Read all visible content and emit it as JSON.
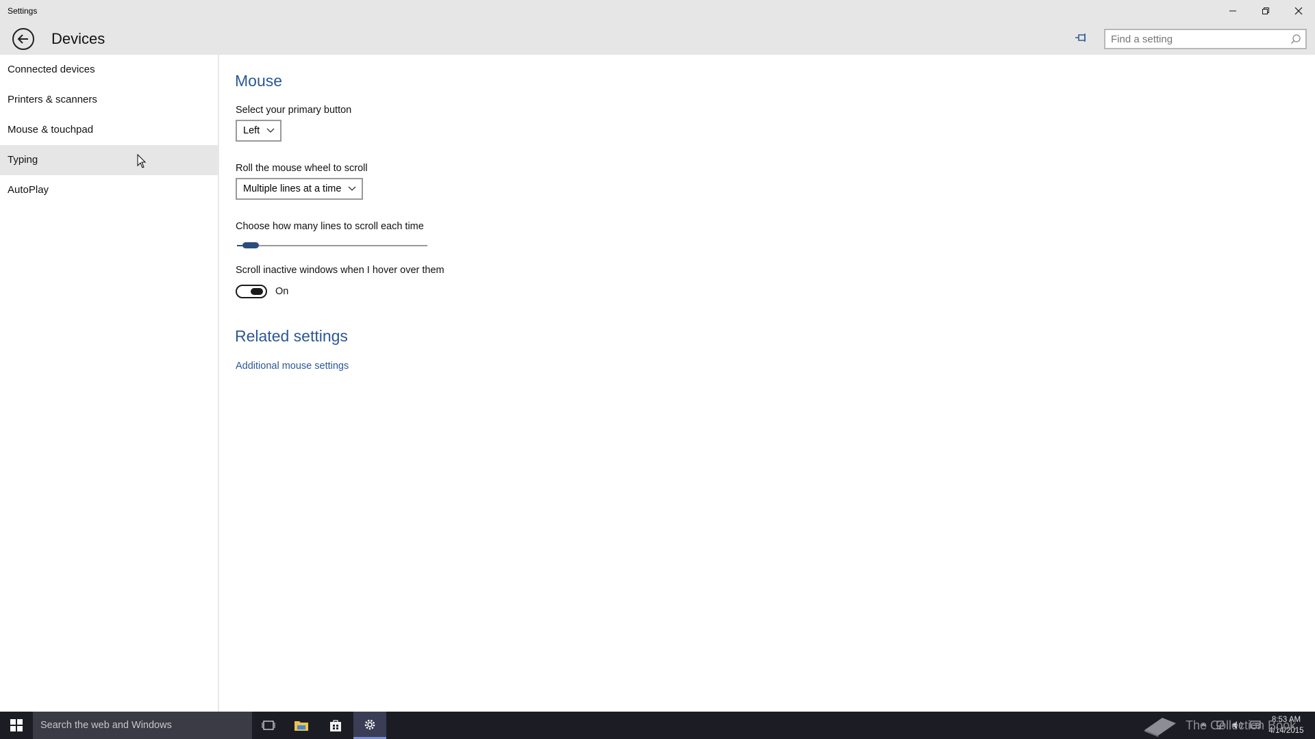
{
  "window": {
    "title": "Settings",
    "controls": [
      "minimize",
      "restore",
      "close"
    ]
  },
  "header": {
    "page_title": "Devices",
    "search_placeholder": "Find a setting"
  },
  "sidebar": {
    "items": [
      {
        "label": "Connected devices"
      },
      {
        "label": "Printers & scanners"
      },
      {
        "label": "Mouse & touchpad"
      },
      {
        "label": "Typing"
      },
      {
        "label": "AutoPlay"
      }
    ],
    "hovered_index": 3
  },
  "main": {
    "section_title": "Mouse",
    "primary_button": {
      "label": "Select your primary button",
      "value": "Left"
    },
    "wheel_scroll": {
      "label": "Roll the mouse wheel to scroll",
      "value": "Multiple lines at a time"
    },
    "lines_to_scroll": {
      "label": "Choose how many lines to scroll each time",
      "slider_fraction": 0.03
    },
    "inactive_scroll": {
      "label": "Scroll inactive windows when I hover over them",
      "state": "On"
    },
    "related_title": "Related settings",
    "related_link": "Additional mouse settings"
  },
  "taskbar": {
    "search_placeholder": "Search the web and Windows",
    "time": "8:53 AM",
    "date": "4/14/2015",
    "watermark": "The Collection Book"
  },
  "colors": {
    "accent": "#2b5797",
    "chrome": "#e6e6e6",
    "taskbar": "#1c1d24"
  }
}
